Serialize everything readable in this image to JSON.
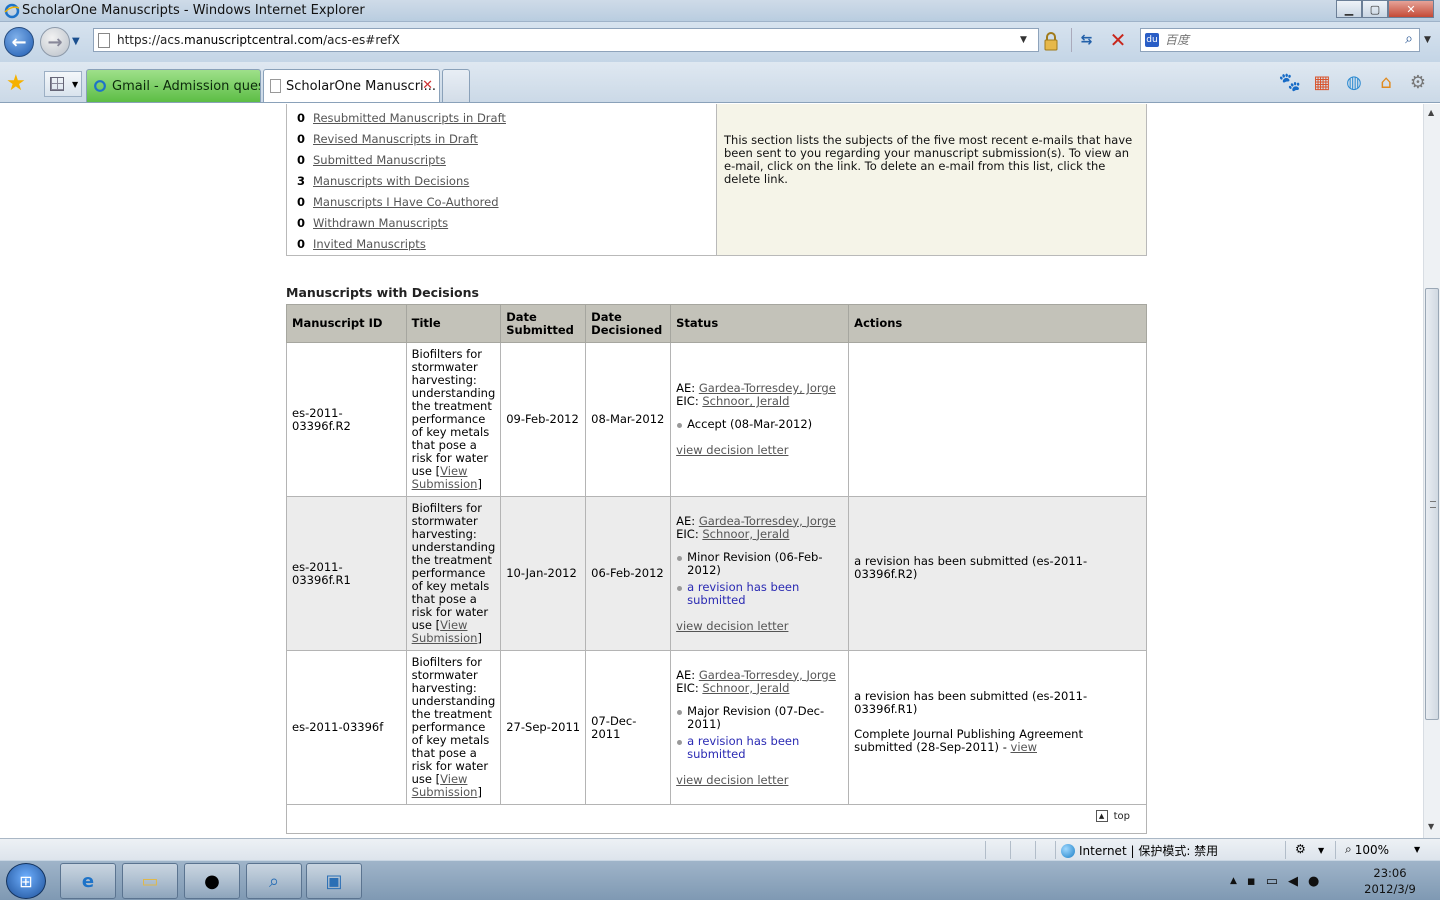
{
  "window": {
    "title": "ScholarOne Manuscripts - Windows Internet Explorer"
  },
  "address": {
    "url_prefix": "https://acs.",
    "url_host": "manuscriptcentral.com",
    "url_path": "/acs-es#refX"
  },
  "search": {
    "placeholder": "百度"
  },
  "tabs": [
    {
      "label": "Gmail - Admission ques..."
    },
    {
      "label": "ScholarOne Manuscri..."
    }
  ],
  "summary": {
    "items": [
      {
        "count": "0",
        "label": "Resubmitted Manuscripts in Draft"
      },
      {
        "count": "0",
        "label": "Revised Manuscripts in Draft"
      },
      {
        "count": "0",
        "label": "Submitted Manuscripts"
      },
      {
        "count": "3",
        "label": "Manuscripts with Decisions"
      },
      {
        "count": "0",
        "label": "Manuscripts I Have Co-Authored"
      },
      {
        "count": "0",
        "label": "Withdrawn Manuscripts"
      },
      {
        "count": "0",
        "label": "Invited Manuscripts"
      }
    ],
    "email_info": "This section lists the subjects of the five most recent e-mails that have been sent to you regarding your manuscript submission(s). To view an e-mail, click on the link. To delete an e-mail from this list, click the delete link."
  },
  "decisions": {
    "section_title": "Manuscripts with Decisions",
    "headers": {
      "manuscript_id": "Manuscript ID",
      "title": "Title",
      "date_submitted": "Date Submitted",
      "date_decisioned": "Date Decisioned",
      "status": "Status",
      "actions": "Actions"
    },
    "rows": [
      {
        "manuscript_id": "es-2011-03396f.R2",
        "title": "Biofilters for stormwater harvesting: understanding the treatment performance of key metals that pose a risk for water use",
        "view_submission": "View Submission",
        "date_submitted": "09-Feb-2012",
        "date_decisioned": "08-Mar-2012",
        "ae_label": "AE:",
        "ae_name": "Gardea-Torresdey, Jorge",
        "eic_label": "EIC:",
        "eic_name": "Schnoor, Jerald",
        "decision": "Accept (08-Mar-2012)",
        "revision_note": "",
        "view_decision": "view decision letter",
        "actions": []
      },
      {
        "manuscript_id": "es-2011-03396f.R1",
        "title": "Biofilters for stormwater harvesting: understanding the treatment performance of key metals that pose a risk for water use",
        "view_submission": "View Submission",
        "date_submitted": "10-Jan-2012",
        "date_decisioned": "06-Feb-2012",
        "ae_label": "AE:",
        "ae_name": "Gardea-Torresdey, Jorge",
        "eic_label": "EIC:",
        "eic_name": "Schnoor, Jerald",
        "decision": "Minor Revision (06-Feb-2012)",
        "revision_note": "a revision has been submitted",
        "view_decision": "view decision letter",
        "actions": [
          "a revision has been submitted (es-2011-03396f.R2)"
        ]
      },
      {
        "manuscript_id": "es-2011-03396f",
        "title": "Biofilters for stormwater harvesting: understanding the treatment performance of key metals that pose a risk for water use",
        "view_submission": "View Submission",
        "date_submitted": "27-Sep-2011",
        "date_decisioned": "07-Dec-2011",
        "ae_label": "AE:",
        "ae_name": "Gardea-Torresdey, Jorge",
        "eic_label": "EIC:",
        "eic_name": "Schnoor, Jerald",
        "decision": "Major Revision (07-Dec-2011)",
        "revision_note": "a revision has been submitted",
        "view_decision": "view decision letter",
        "actions": [
          "a revision has been submitted (es-2011-03396f.R1)",
          "Complete Journal Publishing Agreement submitted (28-Sep-2011) - "
        ],
        "action_link": "view"
      }
    ],
    "top_label": "top"
  },
  "statusbar": {
    "zone": "Internet | 保护模式: 禁用",
    "zoom": "100%"
  },
  "taskbar": {
    "time": "23:06",
    "date": "2012/3/9"
  }
}
